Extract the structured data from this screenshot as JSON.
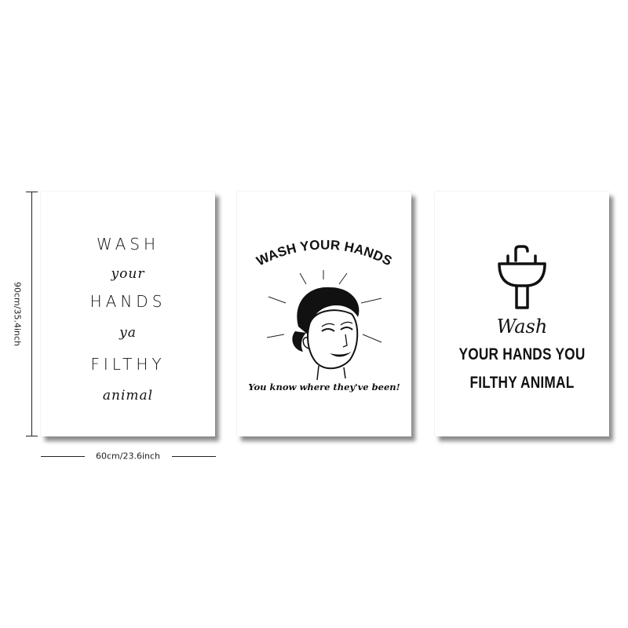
{
  "dimensions": {
    "height_label": "90cm/35.4inch",
    "width_label": "60cm/23.6inch"
  },
  "poster1": {
    "lines": [
      "WASH",
      "your",
      "HANDS",
      "ya",
      "FILTHY",
      "animal"
    ]
  },
  "poster2": {
    "title": "WASH YOUR HANDS",
    "tagline": "You know where they've been!"
  },
  "poster3": {
    "script": "Wash",
    "line1": "YOUR HANDS YOU",
    "line2": "FILTHY ANIMAL"
  },
  "icons": [
    "retro-woman-face-icon",
    "sink-faucet-icon"
  ],
  "colors": {
    "ink": "#111111",
    "paper": "#ffffff"
  }
}
